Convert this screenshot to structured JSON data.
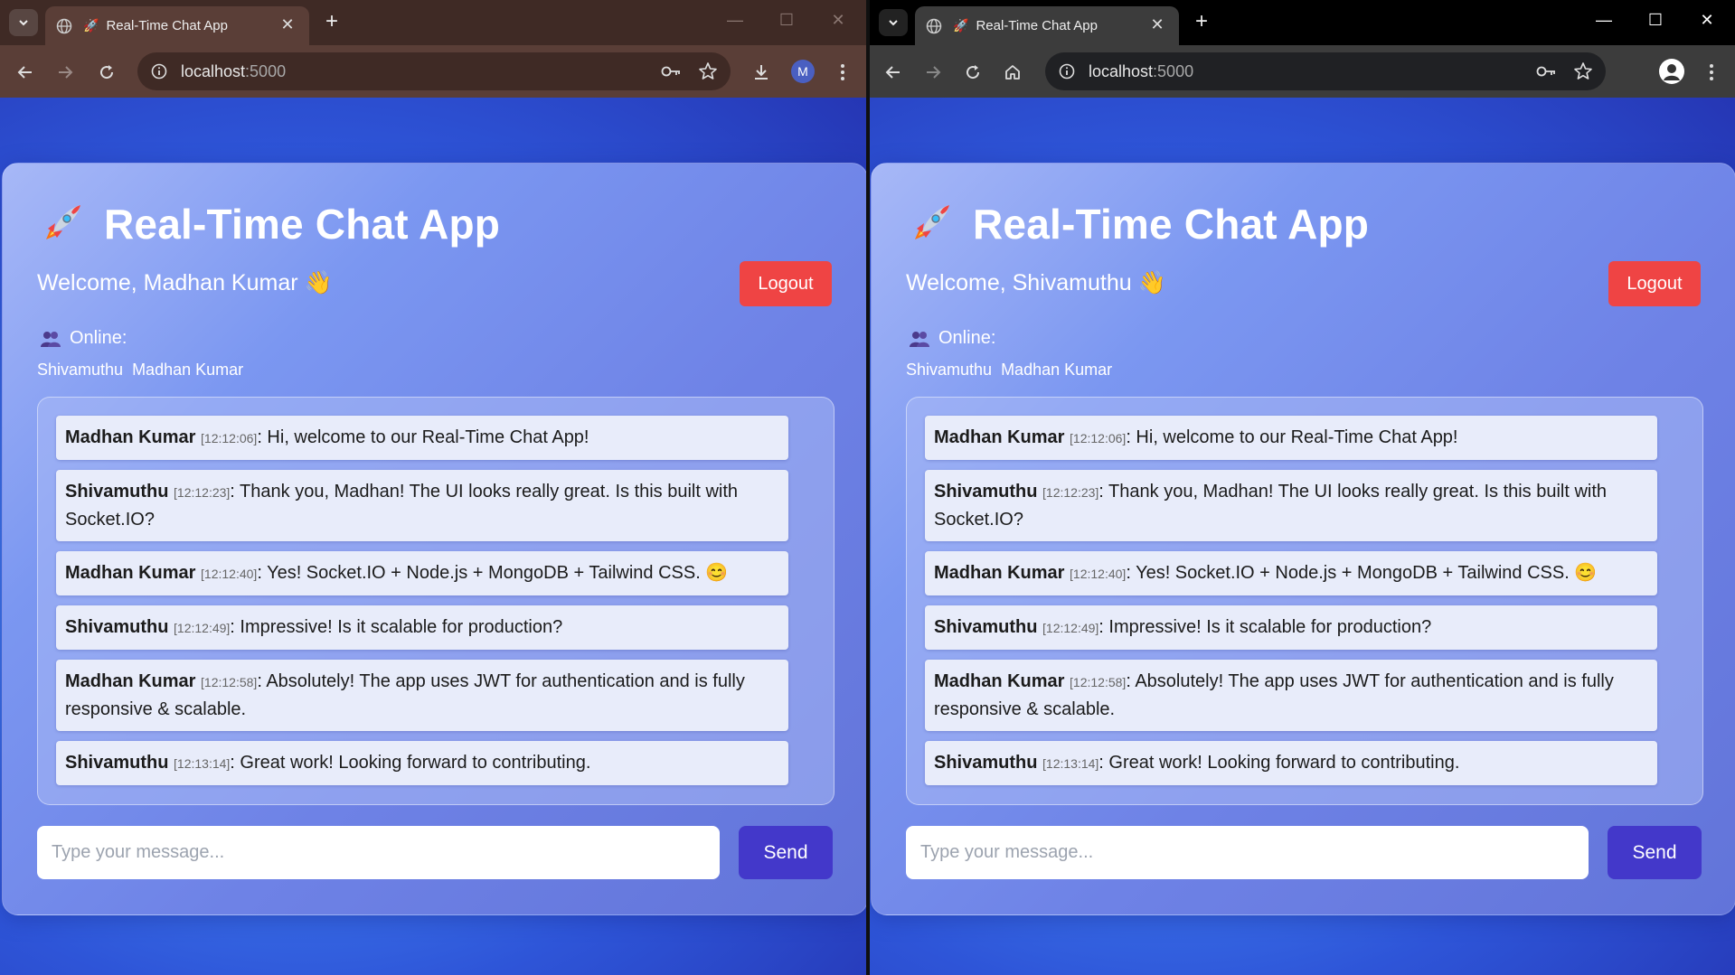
{
  "colors": {
    "logout_bg": "#ef4444",
    "send_bg": "#4338ca",
    "accent_bg": "#3f7df0"
  },
  "browser": {
    "tab_title": "Real-Time Chat App",
    "url_host": "localhost",
    "url_port": ":5000",
    "profile_initial": "M"
  },
  "app": {
    "title": "Real-Time Chat App",
    "logout_label": "Logout",
    "online_label": "Online:",
    "online_users": [
      "Shivamuthu",
      "Madhan Kumar"
    ],
    "input_placeholder": "Type your message...",
    "send_label": "Send",
    "messages": [
      {
        "author": "Madhan Kumar",
        "time": "[12:12:06]",
        "text": ": Hi, welcome to our Real-Time Chat App!"
      },
      {
        "author": "Shivamuthu",
        "time": "[12:12:23]",
        "text": ": Thank you, Madhan! The UI looks really great. Is this built with Socket.IO?"
      },
      {
        "author": "Madhan Kumar",
        "time": "[12:12:40]",
        "text": ": Yes! Socket.IO + Node.js + MongoDB + Tailwind CSS. 😊"
      },
      {
        "author": "Shivamuthu",
        "time": "[12:12:49]",
        "text": ": Impressive! Is it scalable for production?"
      },
      {
        "author": "Madhan Kumar",
        "time": "[12:12:58]",
        "text": ": Absolutely! The app uses JWT for authentication and is fully responsive & scalable."
      },
      {
        "author": "Shivamuthu",
        "time": "[12:13:14]",
        "text": ": Great work! Looking forward to contributing."
      }
    ]
  },
  "window_left": {
    "welcome": "Welcome, Madhan Kumar 👋"
  },
  "window_right": {
    "welcome": "Welcome, Shivamuthu 👋"
  }
}
